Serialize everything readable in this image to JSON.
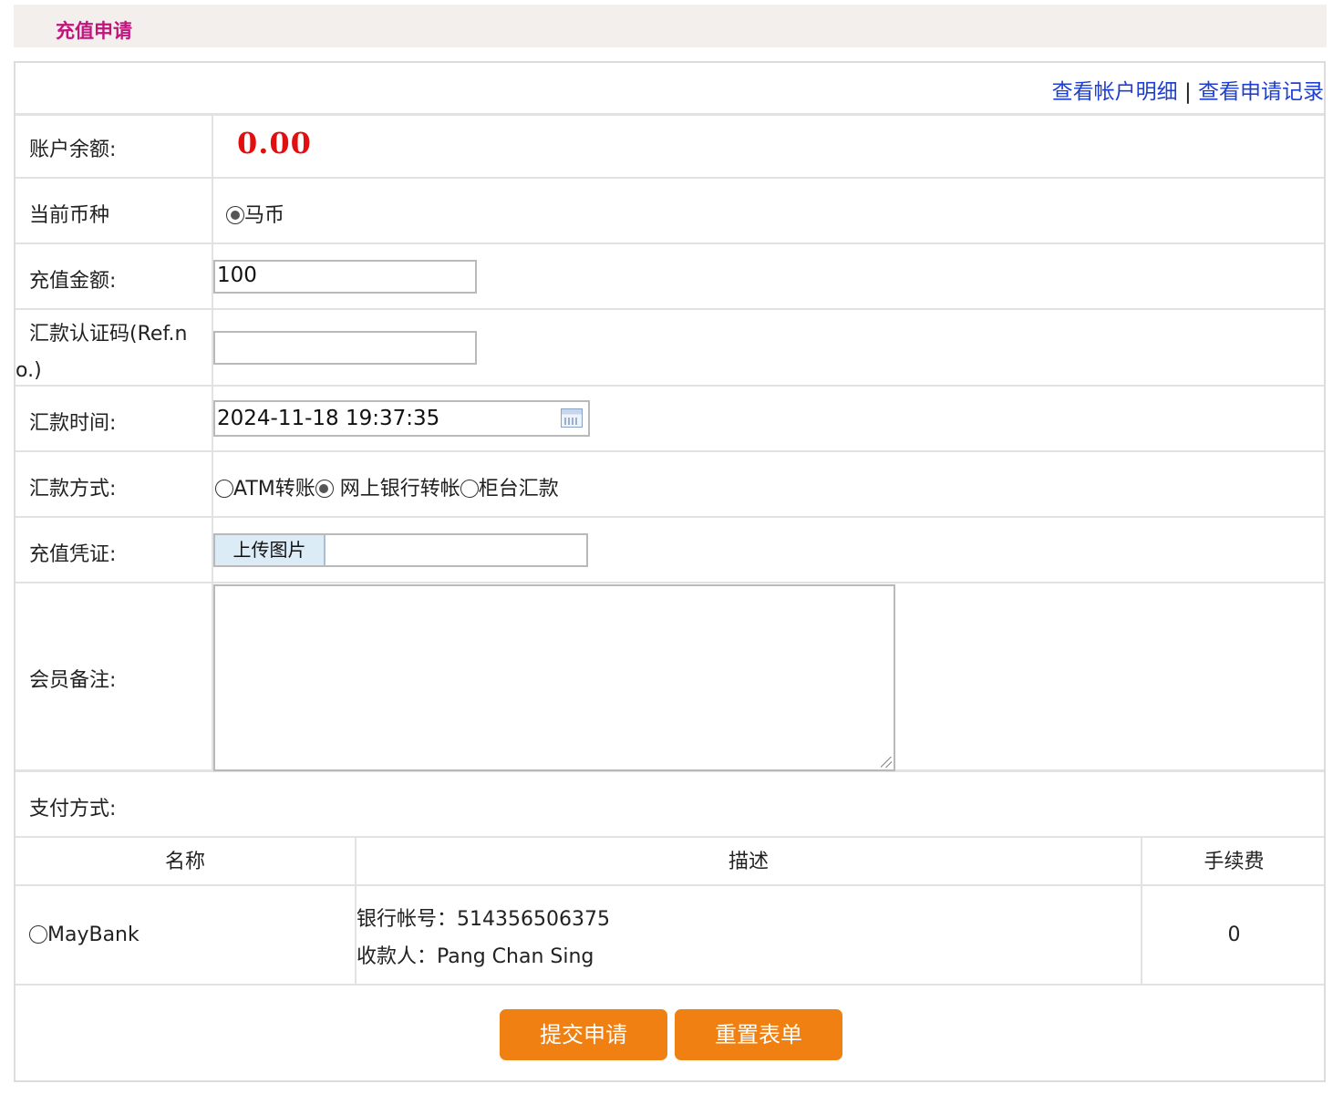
{
  "header": {
    "title": "充值申请"
  },
  "links": {
    "account_detail": "查看帐户明细",
    "separator": "|",
    "apply_records": "查看申请记录"
  },
  "form": {
    "balance_label": "账户余额:",
    "balance_value": "0.00",
    "currency_label": "当前币种",
    "currency_option": "马币",
    "amount_label": "充值金额:",
    "amount_value": "100",
    "ref_label": "汇款认证码(Ref.no.)",
    "ref_value": "",
    "time_label": "汇款时间:",
    "time_value": "2024-11-18 19:37:35",
    "method_label": "汇款方式:",
    "methods": [
      {
        "label": "ATM转账",
        "selected": false
      },
      {
        "label": "网上银行转帐",
        "selected": true
      },
      {
        "label": "柜台汇款",
        "selected": false
      }
    ],
    "voucher_label": "充值凭证:",
    "upload_label": "上传图片",
    "note_label": "会员备注:",
    "note_value": ""
  },
  "payment": {
    "label": "支付方式:",
    "columns": [
      "名称",
      "描述",
      "手续费"
    ],
    "rows": [
      {
        "name": "MayBank",
        "account_line": "银行帐号：514356506375",
        "payee_line": "收款人：Pang Chan Sing",
        "fee": "0",
        "selected": false
      }
    ]
  },
  "actions": {
    "submit": "提交申请",
    "reset": "重置表单"
  },
  "colors": {
    "title": "#c0157c",
    "balance": "#e01010",
    "link": "#1f3fd1",
    "button": "#f08012"
  }
}
